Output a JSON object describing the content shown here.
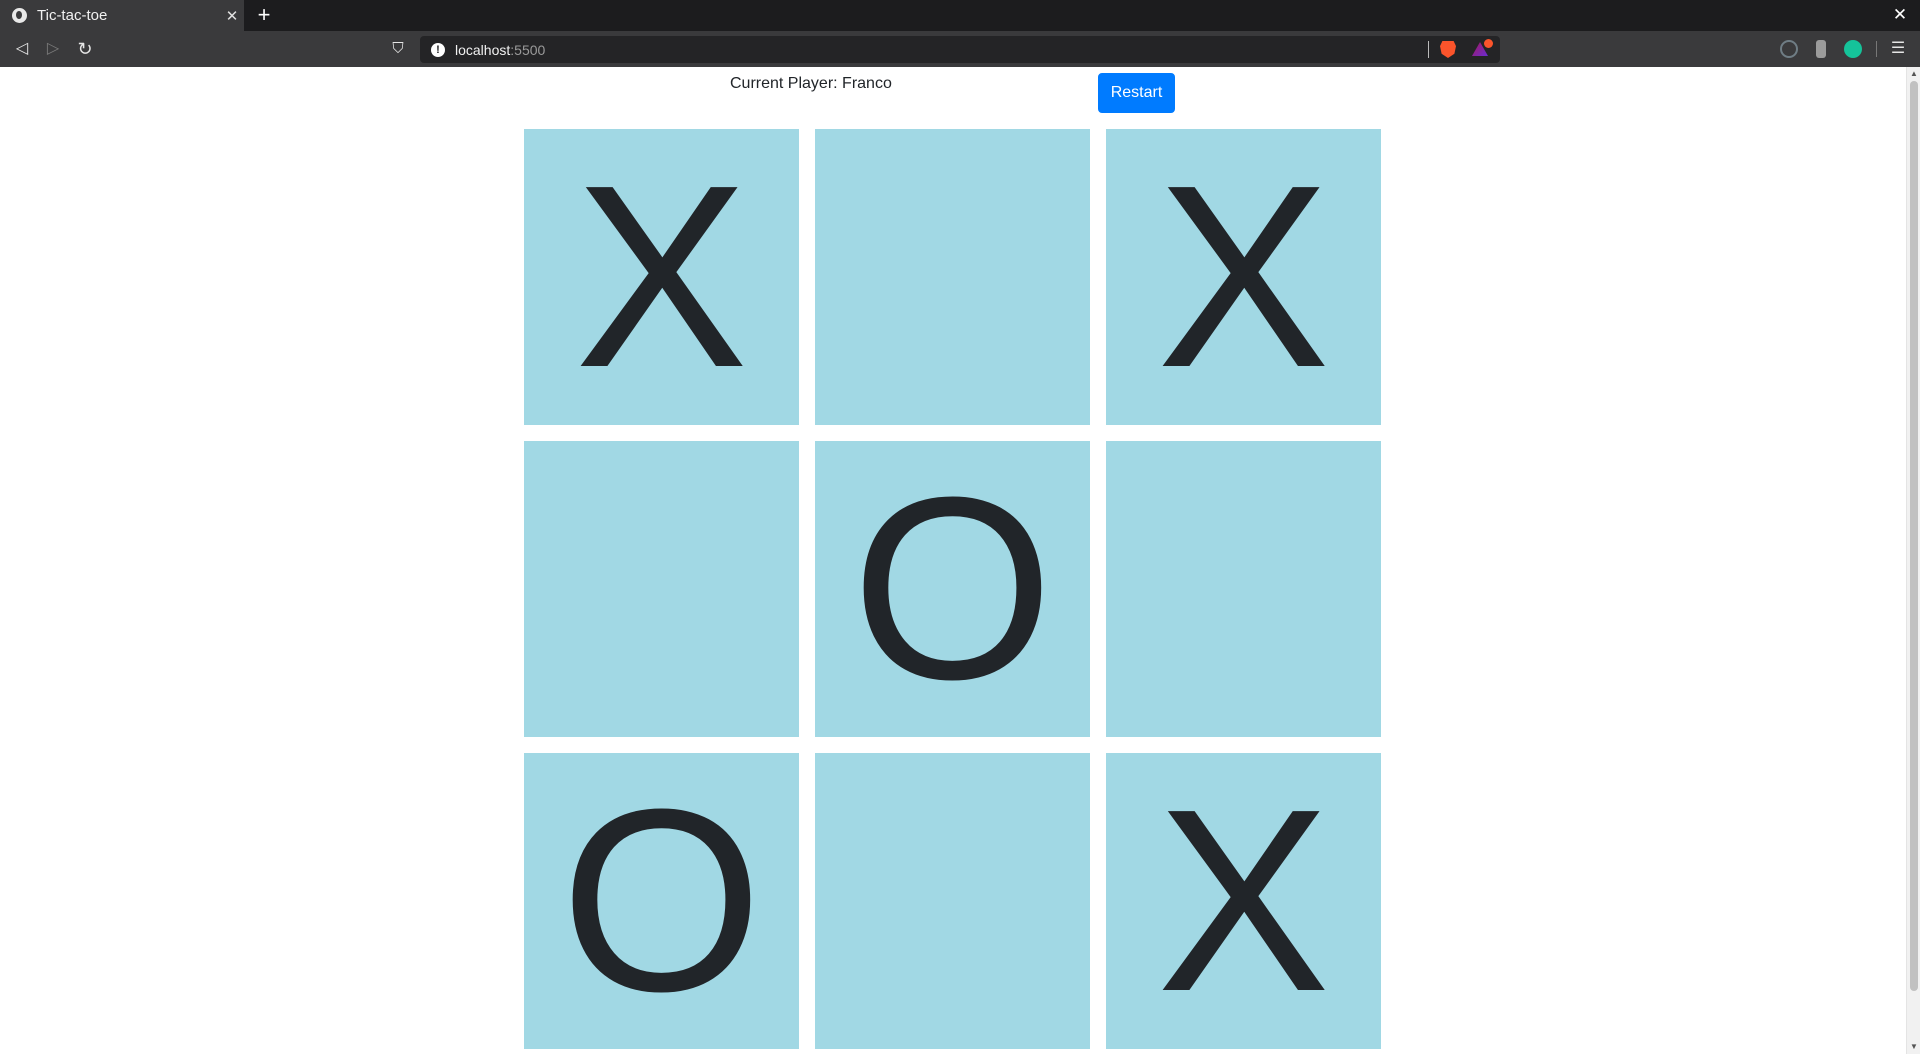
{
  "browser": {
    "tab_title": "Tic-tac-toe",
    "tab_close": "✕",
    "new_tab": "+",
    "window_close": "✕",
    "url_host": "localhost",
    "url_port": ":5500",
    "icons": [
      "back-icon",
      "forward-icon",
      "reload-icon",
      "bookmark-icon",
      "site-info-icon",
      "brave-shields-icon",
      "brave-rewards-icon",
      "extension-icon",
      "menu-icon"
    ]
  },
  "game": {
    "status_prefix": "Current Player: ",
    "current_player": "Franco",
    "restart_label": "Restart",
    "board": [
      "X",
      "",
      "X",
      "",
      "O",
      "",
      "O",
      "",
      "X"
    ],
    "cell_color": "#a1d8e4",
    "mark_color": "#212529",
    "button_color": "#007bff"
  }
}
